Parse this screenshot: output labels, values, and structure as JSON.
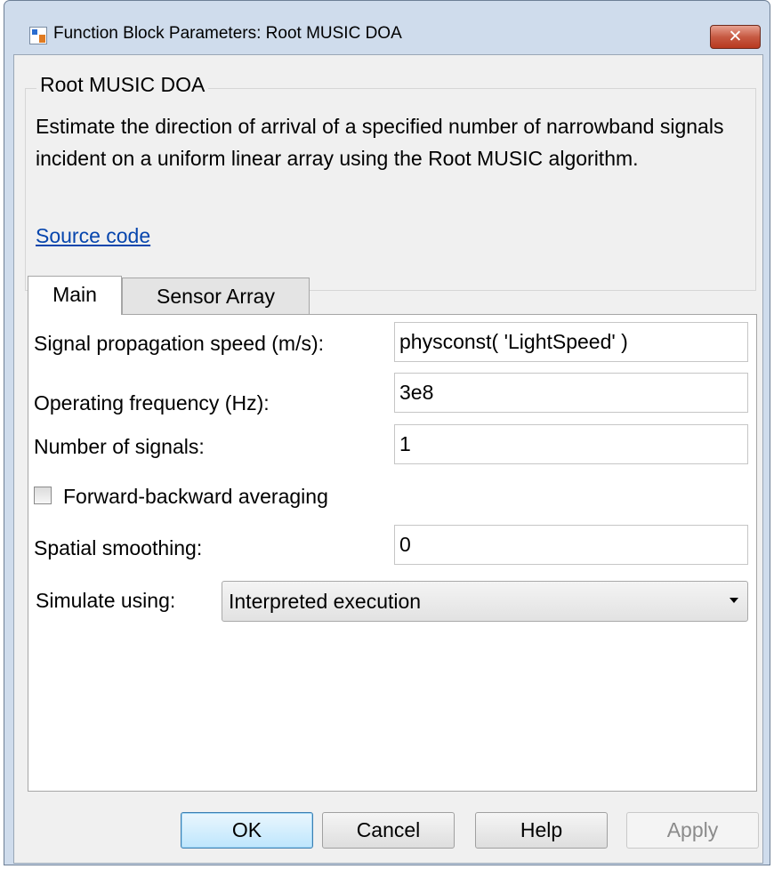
{
  "window": {
    "title": "Function Block Parameters: Root MUSIC DOA",
    "close_label": "✕"
  },
  "block": {
    "name": "Root MUSIC DOA",
    "description": "Estimate the direction of arrival of a specified number of narrowband signals incident on a uniform linear array using the Root MUSIC algorithm.",
    "source_link": "Source code"
  },
  "tabs": [
    {
      "label": "Main",
      "active": true
    },
    {
      "label": "Sensor Array",
      "active": false
    }
  ],
  "params": {
    "propagation_speed": {
      "label": "Signal propagation speed (m/s):",
      "value": "physconst( 'LightSpeed' )"
    },
    "operating_frequency": {
      "label": "Operating frequency (Hz):",
      "value": "3e8"
    },
    "num_signals": {
      "label": "Number of signals:",
      "value": "1"
    },
    "fb_averaging": {
      "label": "Forward-backward averaging",
      "checked": false
    },
    "spatial_smoothing": {
      "label": "Spatial smoothing:",
      "value": "0"
    },
    "simulate_using": {
      "label": "Simulate using:",
      "value": "Interpreted execution"
    }
  },
  "buttons": {
    "ok": "OK",
    "cancel": "Cancel",
    "help": "Help",
    "apply": "Apply"
  }
}
